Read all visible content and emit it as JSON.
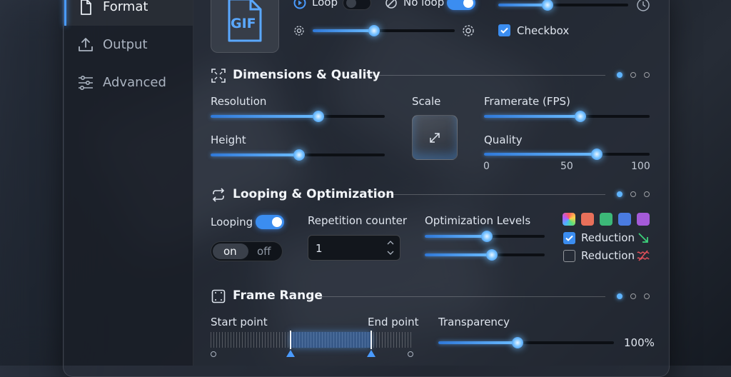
{
  "sidebar": {
    "items": [
      {
        "label": "Format",
        "icon": "file-icon",
        "active": true
      },
      {
        "label": "Output",
        "icon": "upload-icon",
        "active": false
      },
      {
        "label": "Advanced",
        "icon": "sliders-icon",
        "active": false
      }
    ]
  },
  "format": {
    "file_badge": "GIF",
    "loop_label": "Loop",
    "loop_on": false,
    "no_loop_label": "No loop",
    "no_loop_on": true,
    "speed_slider": 0.43,
    "top_right_slider": 0.38,
    "checkbox_label": "Checkbox",
    "checkbox_checked": true
  },
  "dimensions": {
    "title": "Dimensions & Quality",
    "resolution_label": "Resolution",
    "resolution_value": 0.62,
    "height_label": "Height",
    "height_value": 0.51,
    "scale_label": "Scale",
    "framerate_label": "Framerate (FPS)",
    "framerate_value": 0.58,
    "quality_label": "Quality",
    "quality_value": 68,
    "quality_ticks": [
      "0",
      "50",
      "100"
    ]
  },
  "looping": {
    "title": "Looping & Optimization",
    "looping_label": "Looping",
    "looping_on": true,
    "seg_on": "on",
    "seg_off": "off",
    "repetition_label": "Repetition counter",
    "repetition_value": "1",
    "optimization_label": "Optimization Levels",
    "opt_slider_1": 0.52,
    "opt_slider_2": 0.56,
    "swatch_colors": [
      "#e05a5a",
      "#e8705a",
      "#3cb878",
      "#4a7be0",
      "#a45ad8"
    ],
    "reduction_1_label": "Reduction",
    "reduction_1_checked": true,
    "reduction_2_label": "Reduction",
    "reduction_2_checked": false
  },
  "frame_range": {
    "title": "Frame Range",
    "start_label": "Start point",
    "end_label": "End point",
    "transparency_label": "Transparency",
    "transparency_value": "100%",
    "transparency_slider": 0.45
  },
  "colors": {
    "accent": "#3b8df0",
    "accent_glow": "#6bbcff",
    "green": "#3cd07a",
    "red": "#e0505a"
  }
}
